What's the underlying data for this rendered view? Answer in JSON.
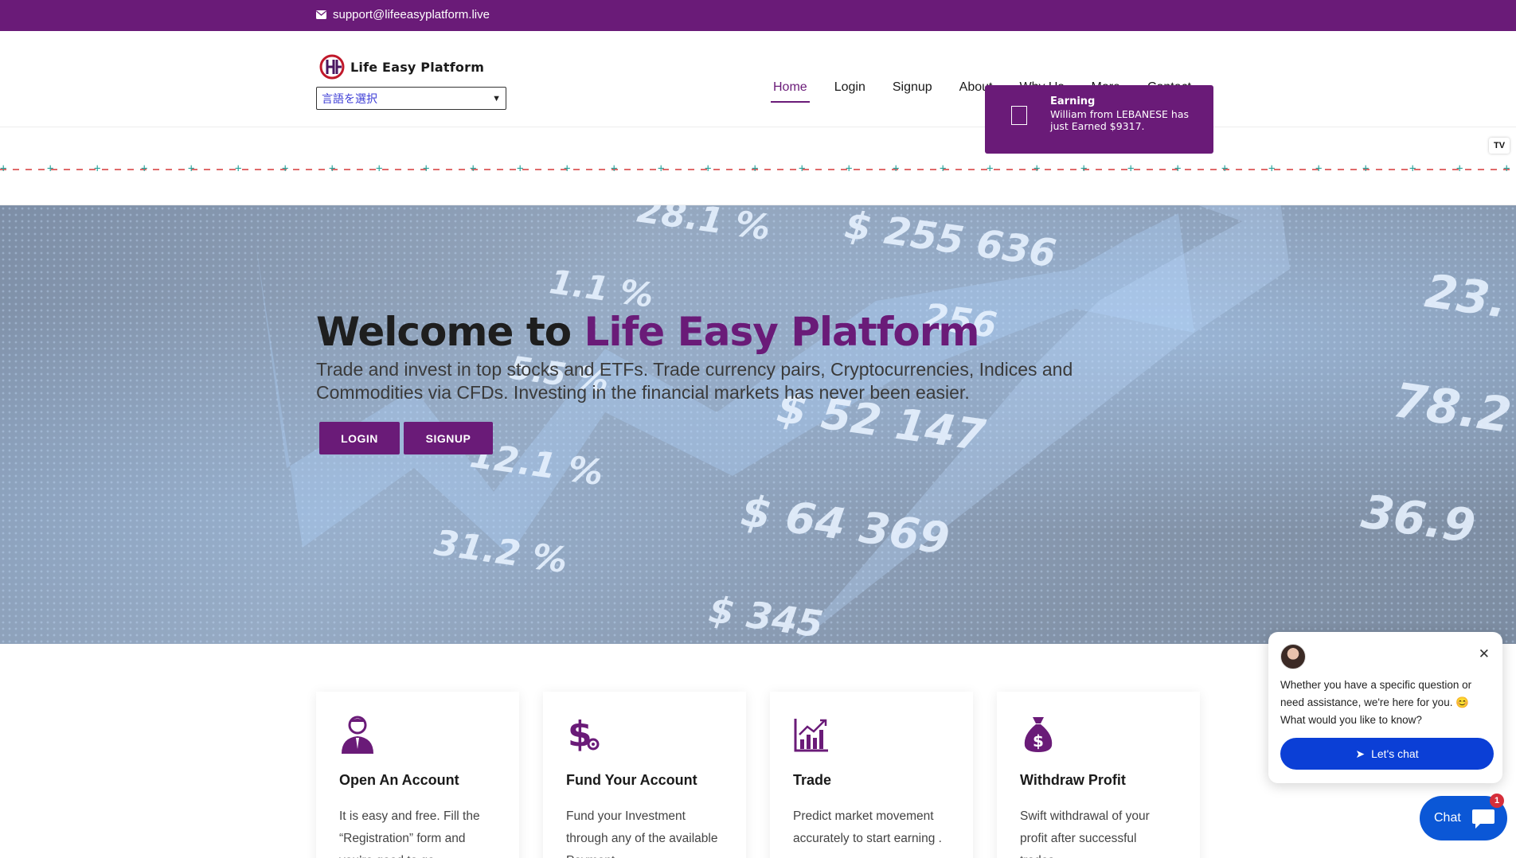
{
  "topbar": {
    "email": "support@lifeeasyplatform.live",
    "icon": "envelope-icon"
  },
  "header": {
    "brand": "Life Easy Platform",
    "language_select": "言語を選択",
    "nav": [
      {
        "label": "Home",
        "active": true
      },
      {
        "label": "Login"
      },
      {
        "label": "Signup"
      },
      {
        "label": "About"
      },
      {
        "label": "Why Us"
      },
      {
        "label": "More"
      },
      {
        "label": "Contact"
      }
    ]
  },
  "notification": {
    "title": "Earning",
    "message": "William from LEBANESE has just Earned $9317."
  },
  "ticker": {
    "logo": "TV"
  },
  "hero": {
    "title_prefix": "Welcome to ",
    "title_accent": "Life Easy Platform",
    "subtitle": "Trade and invest in top stocks and ETFs. Trade currency pairs, Cryptocurrencies, Indices and Commodities via CFDs. Investing in the financial markets has never been easier.",
    "login_label": "LOGIN",
    "signup_label": "SIGNUP",
    "background_numbers": [
      "28.1 %",
      "$ 255 636",
      "1.1 %",
      "23.",
      "256",
      "5.5 %",
      "78.2",
      "$ 52 147",
      "12.1 %",
      "36.9",
      "$ 64 369",
      "31.2 %",
      "$ 345"
    ]
  },
  "features": [
    {
      "icon": "user-icon",
      "title": "Open An Account",
      "text": "It is easy and free. Fill the “Registration” form and you’re good to go."
    },
    {
      "icon": "dollar-icon",
      "title": "Fund Your Account",
      "text": "Fund your Investment through any of the available Payment"
    },
    {
      "icon": "bar-chart-icon",
      "title": "Trade",
      "text": "Predict market movement accurately to start earning ."
    },
    {
      "icon": "money-bag-icon",
      "title": "Withdraw Profit",
      "text": "Swift withdrawal of your profit after successful trades."
    }
  ],
  "chat": {
    "message": "Whether you have a specific question or need assistance, we're here for you. 😊 What would you like to know?",
    "cta": "Let's chat",
    "launcher_label": "Chat",
    "badge": "1"
  },
  "colors": {
    "brand": "#6a1b78",
    "chat": "#0b3fd6"
  }
}
